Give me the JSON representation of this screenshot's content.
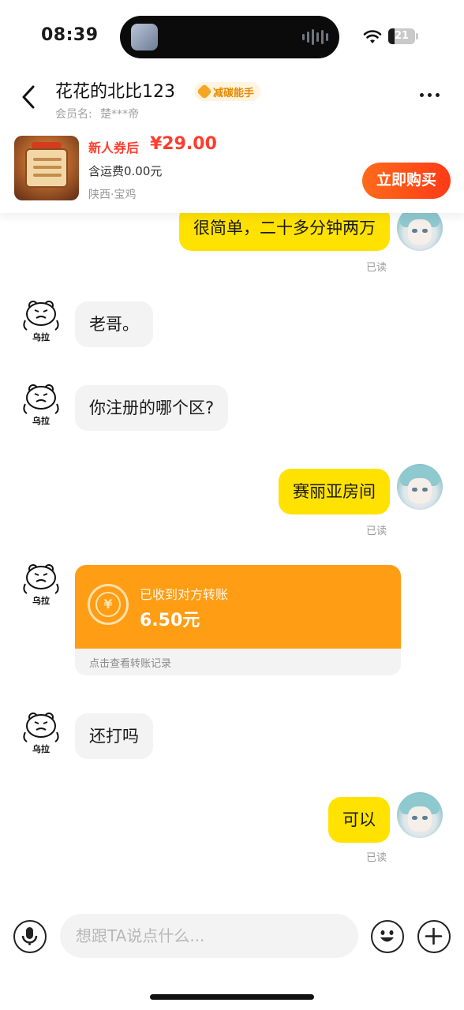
{
  "status_bar": {
    "time": "08:39",
    "battery_level": "21"
  },
  "header": {
    "shop_name": "花花的北比123",
    "badge": "减碳能手",
    "member_label": "会员名:",
    "member_name": "楚***帝"
  },
  "product": {
    "price_tag": "新人券后",
    "price": "¥29.00",
    "shipping": "含运费0.00元",
    "location": "陕西·宝鸡",
    "buy_label": "立即购买"
  },
  "messages": [
    {
      "sender": "self",
      "text": "很简单，二十多分钟两万",
      "read": "已读"
    },
    {
      "sender": "other",
      "avatar_label": "乌拉",
      "text": "老哥。"
    },
    {
      "sender": "other",
      "avatar_label": "乌拉",
      "text": "你注册的哪个区?"
    },
    {
      "sender": "self",
      "text": "赛丽亚房间",
      "read": "已读"
    },
    {
      "sender": "other",
      "avatar_label": "乌拉",
      "type": "transfer",
      "transfer": {
        "title": "已收到对方转账",
        "amount": "6.50元",
        "footer": "点击查看转账记录",
        "icon": "¥"
      }
    },
    {
      "sender": "other",
      "avatar_label": "乌拉",
      "text": "还打吗"
    },
    {
      "sender": "self",
      "text": "可以",
      "read": "已读"
    }
  ],
  "input_bar": {
    "placeholder": "想跟TA说点什么..."
  },
  "colors": {
    "self_bubble": "#ffe200",
    "other_bubble": "#f3f3f3",
    "transfer": "#ff9d14",
    "accent": "#ff3d2e"
  }
}
